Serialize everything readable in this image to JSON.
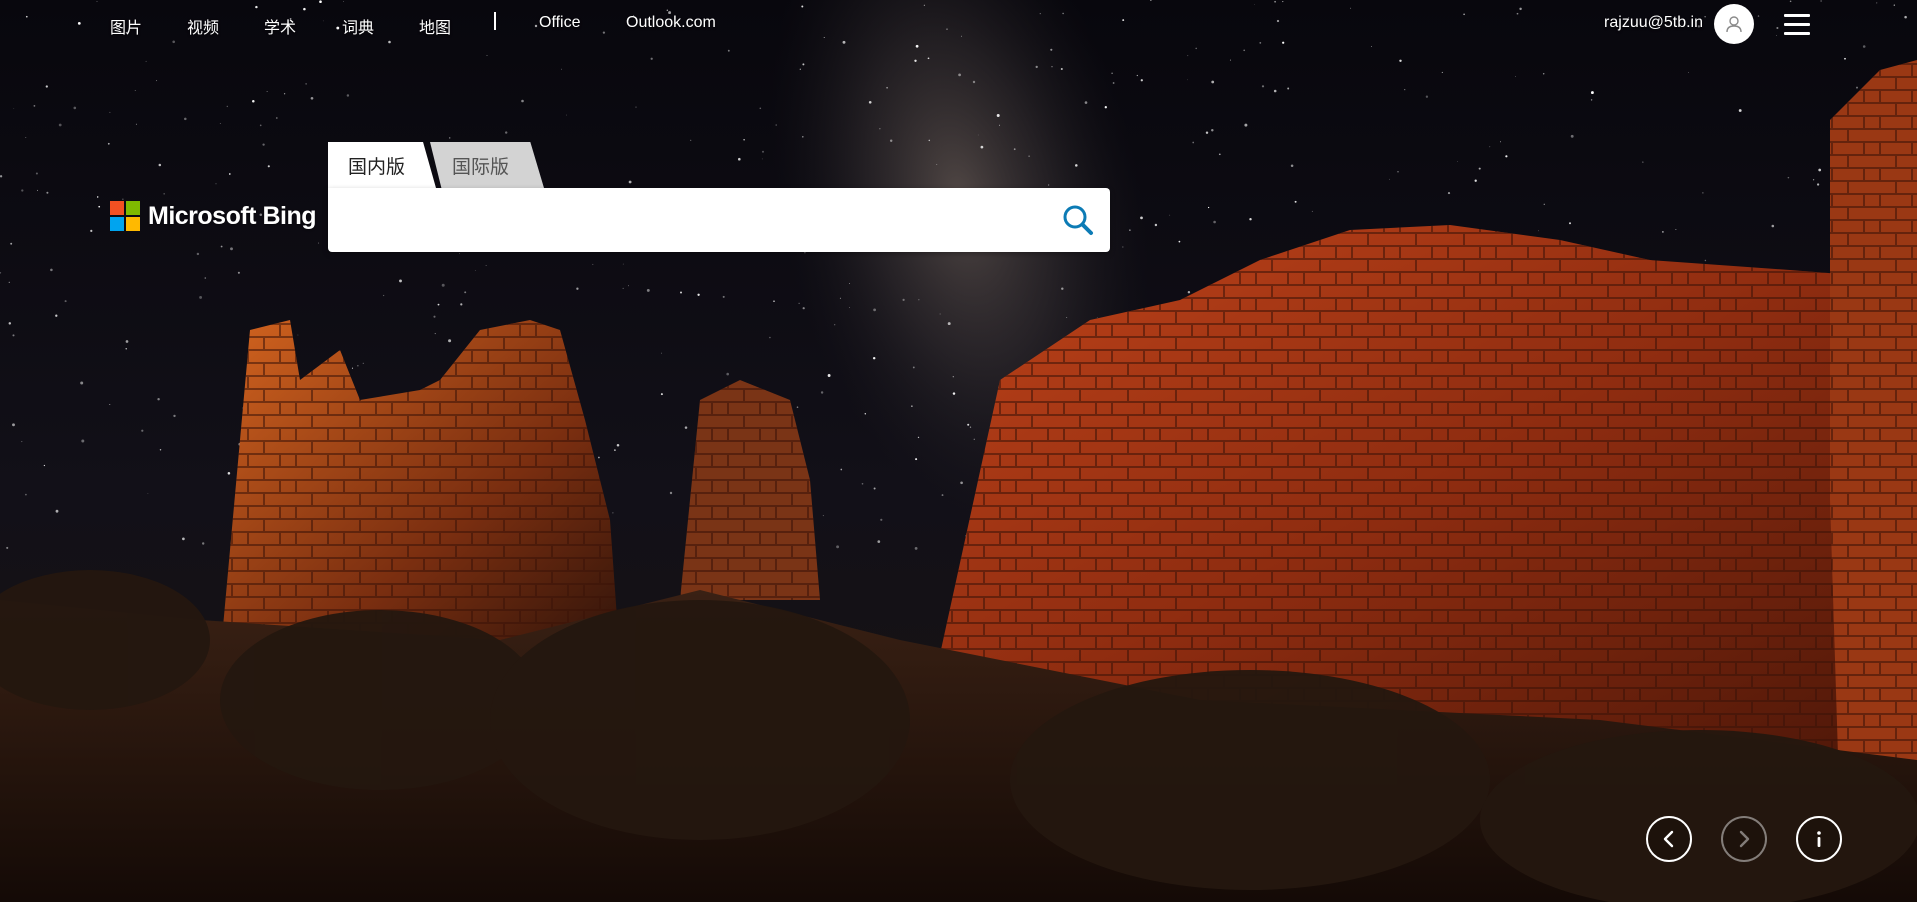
{
  "nav": {
    "items": [
      {
        "label": "图片"
      },
      {
        "label": "视频"
      },
      {
        "label": "学术"
      },
      {
        "label": "词典"
      },
      {
        "label": "地图"
      }
    ],
    "links": [
      {
        "label": "Office"
      },
      {
        "label": "Outlook.com"
      }
    ]
  },
  "user": {
    "email": "rajzuu@5tb.in"
  },
  "logo": {
    "text": "Microsoft Bing"
  },
  "search": {
    "tabs": [
      {
        "label": "国内版",
        "active": true
      },
      {
        "label": "国际版",
        "active": false
      }
    ],
    "value": "",
    "placeholder": ""
  },
  "controls": {
    "prev": {
      "icon": "chevron-left-icon"
    },
    "next": {
      "icon": "chevron-right-icon",
      "disabled": true
    },
    "info": {
      "icon": "info-icon"
    }
  },
  "colors": {
    "accent": "#0c7bb5",
    "ms_red": "#f25022",
    "ms_green": "#7fba00",
    "ms_blue": "#00a4ef",
    "ms_yellow": "#ffb900"
  }
}
